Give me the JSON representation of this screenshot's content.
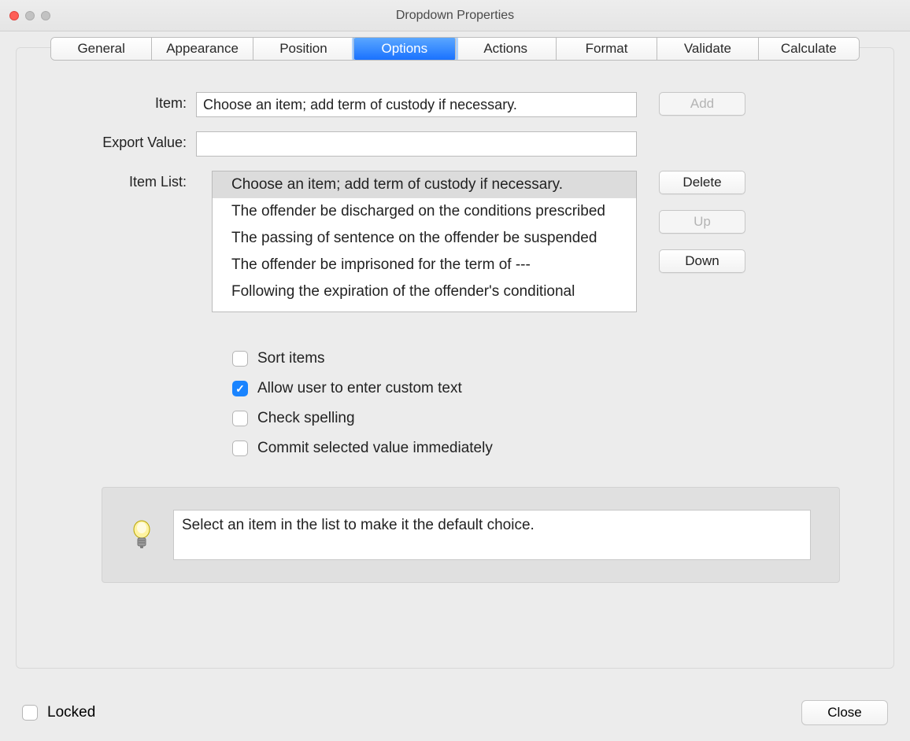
{
  "window": {
    "title": "Dropdown Properties"
  },
  "tabs": {
    "general": "General",
    "appearance": "Appearance",
    "position": "Position",
    "options": "Options",
    "actions": "Actions",
    "format": "Format",
    "validate": "Validate",
    "calculate": "Calculate"
  },
  "labels": {
    "item": "Item:",
    "export_value": "Export Value:",
    "item_list": "Item List:"
  },
  "fields": {
    "item_value": "Choose an item; add term of custody if necessary.",
    "export_value": ""
  },
  "buttons": {
    "add": "Add",
    "delete": "Delete",
    "up": "Up",
    "down": "Down",
    "close": "Close"
  },
  "item_list": [
    "Choose an item; add term of custody if necessary.",
    "The offender be discharged on the conditions prescribed",
    "The passing of sentence on the offender be suspended",
    "The offender be imprisoned for the term of  ---",
    "Following the expiration of the offender's conditional"
  ],
  "checkboxes": {
    "sort_items": "Sort items",
    "allow_custom": "Allow user to enter custom text",
    "check_spelling": "Check spelling",
    "commit_immediately": "Commit selected value immediately"
  },
  "hint": "Select an item in the list to make it the default choice.",
  "footer": {
    "locked": "Locked"
  }
}
